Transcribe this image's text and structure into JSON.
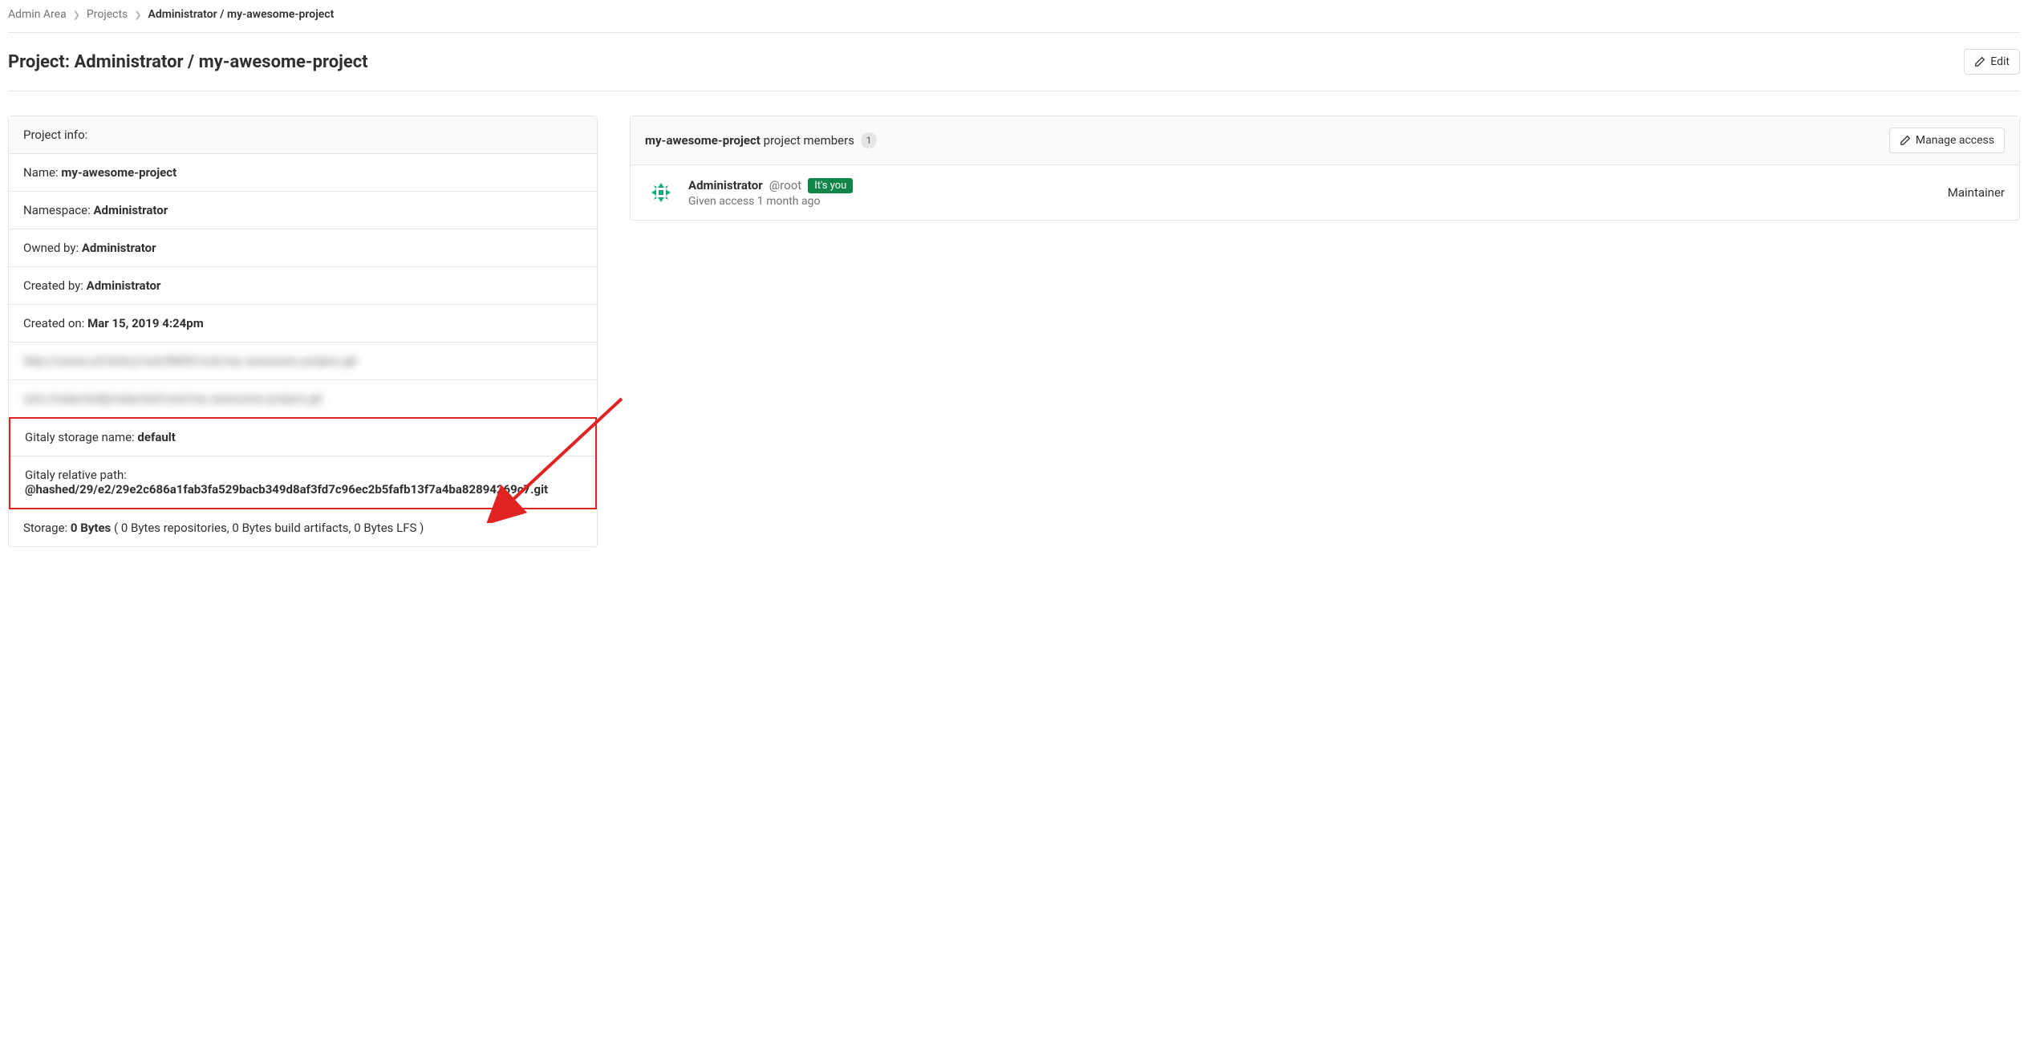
{
  "breadcrumb": {
    "admin_area": "Admin Area",
    "projects": "Projects",
    "current": "Administrator / my-awesome-project"
  },
  "page": {
    "title": "Project: Administrator / my-awesome-project",
    "edit_label": "Edit"
  },
  "project_info": {
    "header": "Project info:",
    "name_label": "Name: ",
    "name_value": "my-awesome-project",
    "namespace_label": "Namespace: ",
    "namespace_value": "Administrator",
    "owned_by_label": "Owned by: ",
    "owned_by_value": "Administrator",
    "created_by_label": "Created by: ",
    "created_by_value": "Administrator",
    "created_on_label": "Created on: ",
    "created_on_value": "Mar 15, 2019 4:24pm",
    "blurred1": "http://some:url/entry/root/8805/root/my-awesome-project.git",
    "blurred2": "ssh://redacted@redacted/root/my-awesome-project.git",
    "gitaly_storage_label": "Gitaly storage name: ",
    "gitaly_storage_value": "default",
    "gitaly_path_label": "Gitaly relative path:",
    "gitaly_path_value": "@hashed/29/e2/29e2c686a1fab3fa529bacb349d8af3fd7c96ec2b5fafb13f7a4ba82894269c7.git",
    "storage_label": "Storage: ",
    "storage_value": "0 Bytes",
    "storage_detail": " ( 0 Bytes repositories, 0 Bytes build artifacts, 0 Bytes LFS )"
  },
  "members": {
    "project_name": "my-awesome-project",
    "header_suffix": " project members",
    "count": "1",
    "manage_label": "Manage access",
    "member": {
      "name": "Administrator",
      "handle": "@root",
      "you_badge": "It's you",
      "access_given": "Given access 1 month ago",
      "role": "Maintainer"
    }
  }
}
